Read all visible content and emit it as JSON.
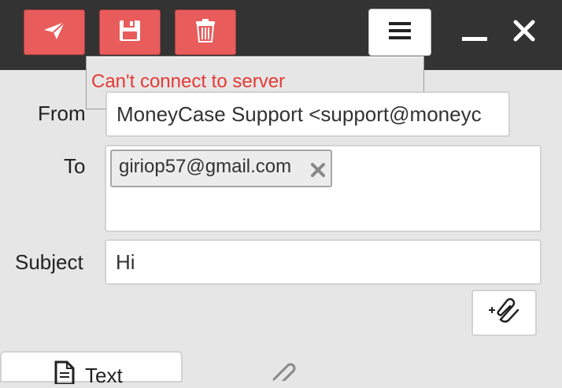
{
  "toolbar": {
    "send_icon": "paper-plane-icon",
    "save_icon": "floppy-disk-icon",
    "delete_icon": "trash-icon",
    "menu_icon": "hamburger-menu-icon",
    "minimize_icon": "minimize-icon",
    "close_icon": "close-icon",
    "button_color": "#e85c5c",
    "bar_color": "#333333"
  },
  "error": {
    "message": "Can't connect to server",
    "color": "#e53935"
  },
  "form": {
    "from_label": "From",
    "from_value": "MoneyCase Support <support@moneyc",
    "to_label": "To",
    "to_recipients": [
      {
        "email": "giriop57@gmail.com"
      }
    ],
    "subject_label": "Subject",
    "subject_value": "Hi",
    "attach_icon": "add-attachment-icon"
  },
  "tabs": [
    {
      "label": "Text",
      "icon": "document-icon",
      "active": true
    },
    {
      "label": "",
      "icon": "paperclip-icon",
      "active": false
    }
  ]
}
